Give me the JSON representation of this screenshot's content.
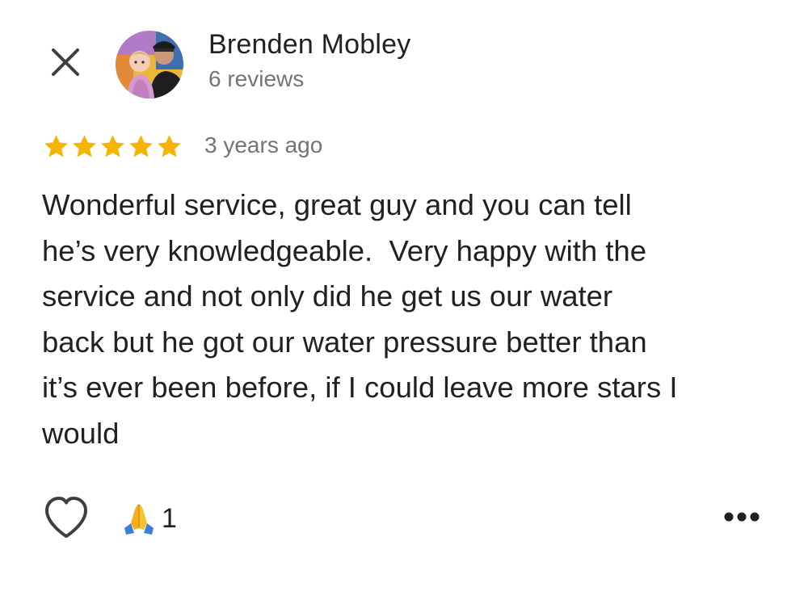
{
  "review": {
    "author_name": "Brenden Mobley",
    "review_count_text": "6 reviews",
    "rating": 5,
    "rating_max": 5,
    "time_ago": "3 years ago",
    "text": "Wonderful service, great guy and you can tell\nhe’s very knowledgeable.  Very happy with the\nservice and not only did he get us our water\nback but he got our water pressure better than\nit’s ever been before, if I could leave more stars I\nwould",
    "reaction_count": "1"
  },
  "icons": {
    "close": "close-icon",
    "avatar": "user-avatar",
    "star": "star-icon",
    "like": "heart-outline-icon",
    "reaction": "folded-hands-emoji-icon",
    "more": "more-horiz-icon"
  },
  "colors": {
    "star": "#f4b400",
    "text_primary": "#202124",
    "text_secondary": "#70757a",
    "icon": "#3c4043"
  }
}
